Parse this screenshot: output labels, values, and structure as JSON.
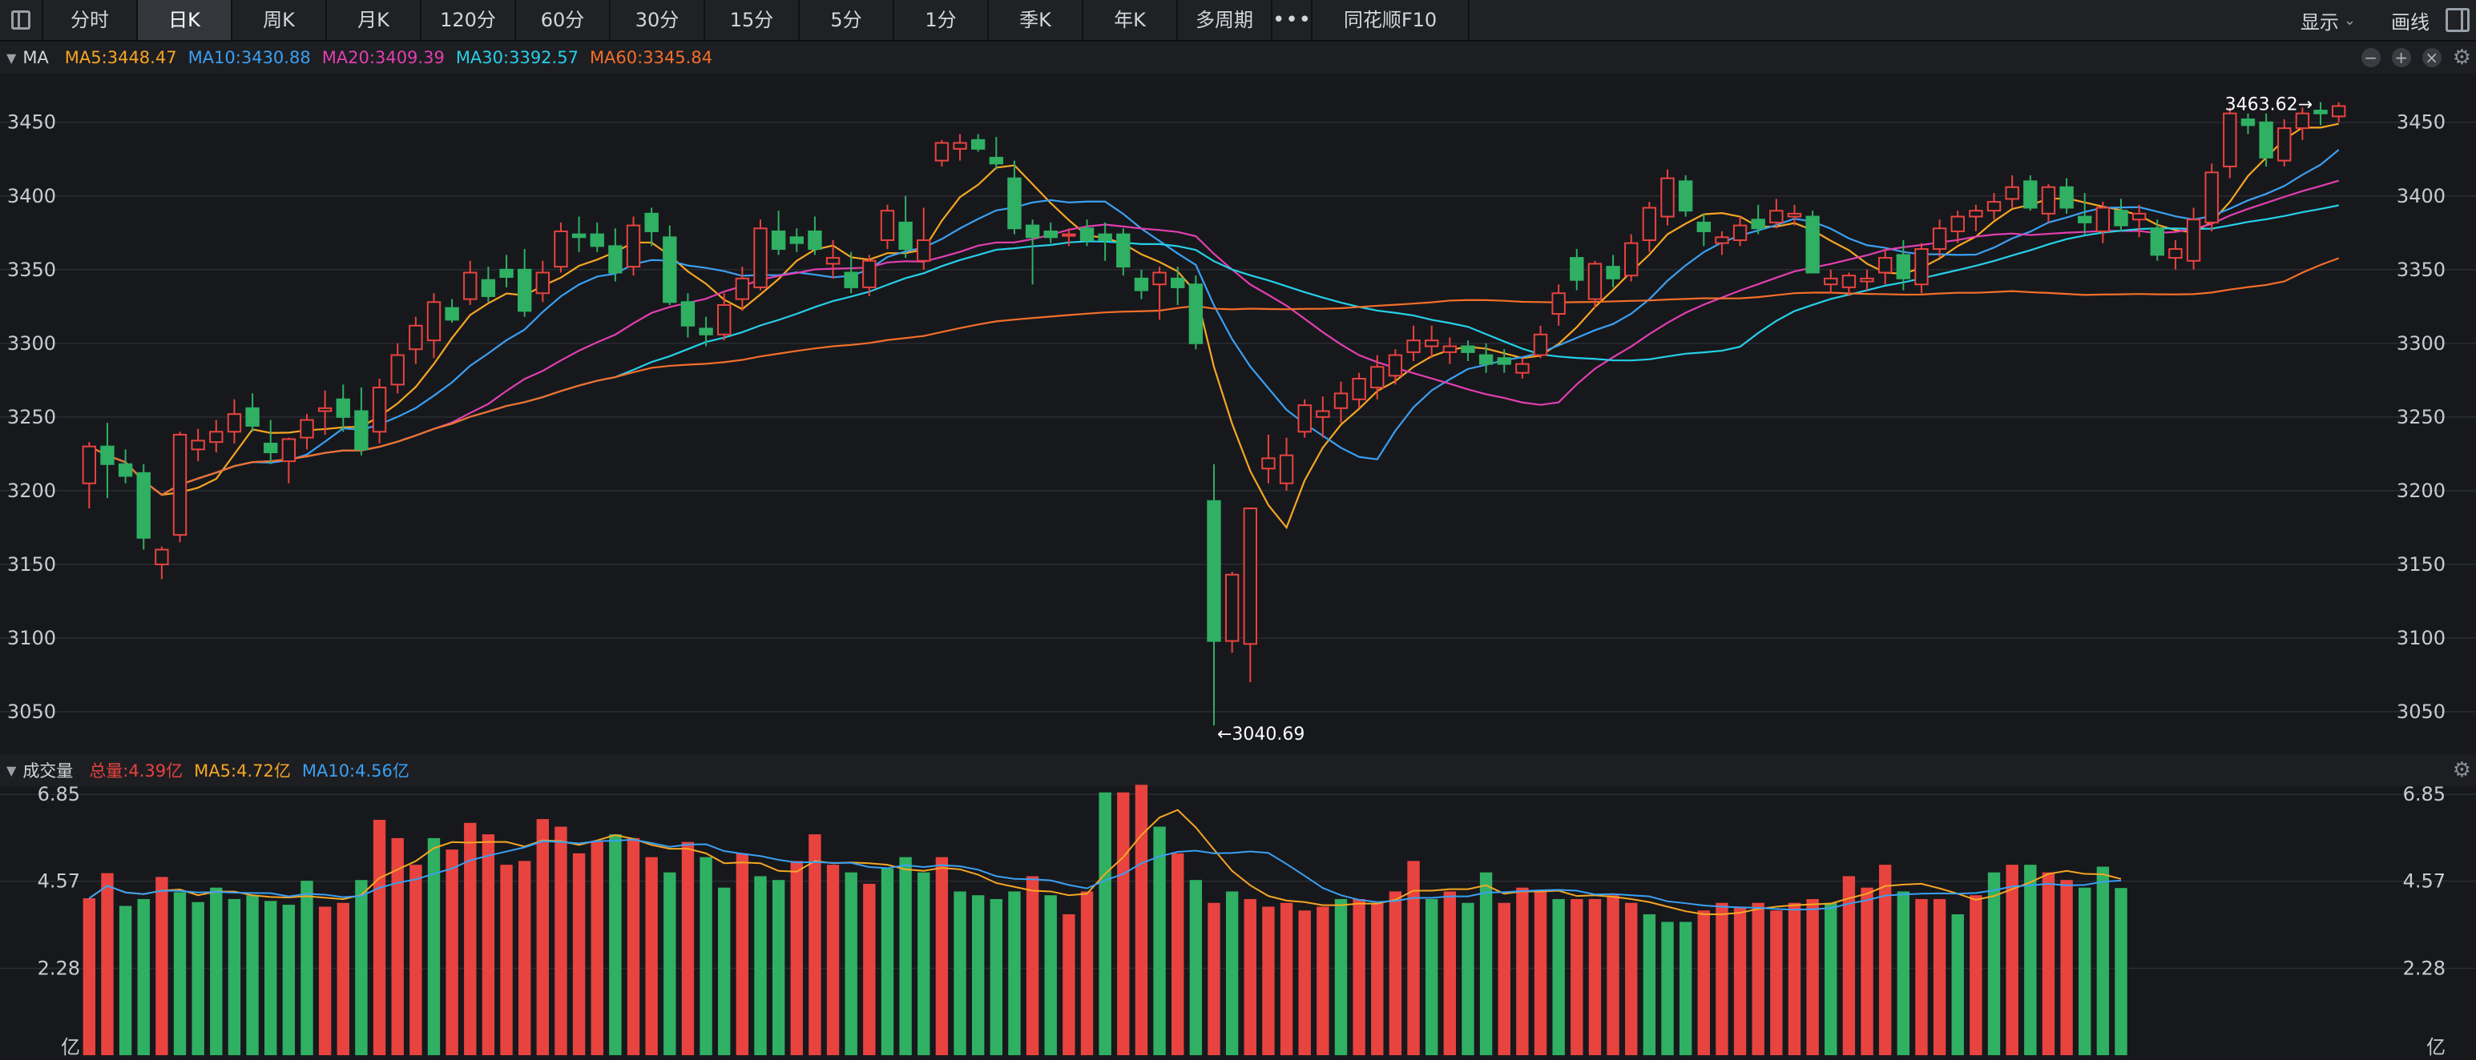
{
  "toolbar": {
    "tabs": [
      "分时",
      "日K",
      "周K",
      "月K",
      "120分",
      "60分",
      "30分",
      "15分",
      "5分",
      "1分",
      "季K",
      "年K",
      "多周期"
    ],
    "active_tab": "日K",
    "more": "•••",
    "f10": "同花顺F10",
    "display": "显示",
    "draw": "画线"
  },
  "ma_legend": {
    "name": "MA",
    "items": [
      {
        "label": "MA5:3448.47",
        "color": "#f5a623"
      },
      {
        "label": "MA10:3430.88",
        "color": "#3aa0f3"
      },
      {
        "label": "MA20:3409.39",
        "color": "#e23fb1"
      },
      {
        "label": "MA30:3392.57",
        "color": "#26d0e8"
      },
      {
        "label": "MA60:3345.84",
        "color": "#f36f2a"
      }
    ]
  },
  "vol_legend": {
    "name": "成交量",
    "items": [
      {
        "label": "总量:4.39亿",
        "color": "#e8433f"
      },
      {
        "label": "MA5:4.72亿",
        "color": "#f5a623"
      },
      {
        "label": "MA10:4.56亿",
        "color": "#3aa0f3"
      }
    ]
  },
  "colors": {
    "up": "#e8433f",
    "down": "#2fb063",
    "grid": "#2a2c31",
    "axis_text": "#c9cbd1"
  },
  "chart_data": {
    "type": "candlestick",
    "price_axis": {
      "ticks": [
        3050,
        3100,
        3150,
        3200,
        3250,
        3300,
        3350,
        3400,
        3450
      ],
      "ylim": [
        3025,
        3483
      ]
    },
    "annotations": {
      "max_label": "3463.62→",
      "min_label": "←3040.69",
      "max": 3463.62,
      "min": 3040.69
    },
    "ohlc": [
      [
        3205,
        3233,
        3188,
        3230
      ],
      [
        3230,
        3246,
        3195,
        3218
      ],
      [
        3218,
        3228,
        3205,
        3210
      ],
      [
        3212,
        3218,
        3160,
        3168
      ],
      [
        3150,
        3162,
        3140,
        3160
      ],
      [
        3170,
        3240,
        3165,
        3238
      ],
      [
        3228,
        3242,
        3220,
        3234
      ],
      [
        3233,
        3248,
        3226,
        3240
      ],
      [
        3240,
        3262,
        3232,
        3252
      ],
      [
        3256,
        3266,
        3240,
        3244
      ],
      [
        3232,
        3248,
        3218,
        3226
      ],
      [
        3220,
        3236,
        3205,
        3235
      ],
      [
        3236,
        3252,
        3228,
        3248
      ],
      [
        3254,
        3268,
        3238,
        3256
      ],
      [
        3262,
        3272,
        3240,
        3250
      ],
      [
        3254,
        3270,
        3224,
        3228
      ],
      [
        3240,
        3276,
        3232,
        3270
      ],
      [
        3272,
        3300,
        3266,
        3292
      ],
      [
        3296,
        3318,
        3286,
        3312
      ],
      [
        3302,
        3334,
        3290,
        3328
      ],
      [
        3324,
        3330,
        3314,
        3316
      ],
      [
        3330,
        3356,
        3326,
        3348
      ],
      [
        3343,
        3352,
        3328,
        3332
      ],
      [
        3350,
        3360,
        3338,
        3345
      ],
      [
        3350,
        3364,
        3318,
        3322
      ],
      [
        3334,
        3356,
        3328,
        3348
      ],
      [
        3352,
        3382,
        3348,
        3376
      ],
      [
        3374,
        3386,
        3362,
        3372
      ],
      [
        3374,
        3382,
        3362,
        3366
      ],
      [
        3366,
        3378,
        3342,
        3348
      ],
      [
        3352,
        3386,
        3346,
        3380
      ],
      [
        3388,
        3392,
        3366,
        3376
      ],
      [
        3372,
        3380,
        3326,
        3328
      ],
      [
        3328,
        3334,
        3304,
        3312
      ],
      [
        3310,
        3318,
        3298,
        3306
      ],
      [
        3306,
        3334,
        3302,
        3326
      ],
      [
        3330,
        3352,
        3322,
        3344
      ],
      [
        3338,
        3384,
        3336,
        3378
      ],
      [
        3376,
        3390,
        3360,
        3364
      ],
      [
        3372,
        3378,
        3362,
        3368
      ],
      [
        3376,
        3386,
        3360,
        3364
      ],
      [
        3354,
        3370,
        3344,
        3358
      ],
      [
        3348,
        3362,
        3334,
        3338
      ],
      [
        3338,
        3360,
        3332,
        3356
      ],
      [
        3370,
        3394,
        3364,
        3390
      ],
      [
        3382,
        3400,
        3358,
        3364
      ],
      [
        3356,
        3392,
        3350,
        3370
      ],
      [
        3424,
        3438,
        3420,
        3436
      ],
      [
        3432,
        3442,
        3424,
        3436
      ],
      [
        3438,
        3442,
        3430,
        3432
      ],
      [
        3426,
        3440,
        3418,
        3422
      ],
      [
        3412,
        3424,
        3374,
        3378
      ],
      [
        3380,
        3384,
        3340,
        3372
      ],
      [
        3376,
        3382,
        3368,
        3372
      ],
      [
        3374,
        3378,
        3366,
        3374
      ],
      [
        3378,
        3384,
        3366,
        3370
      ],
      [
        3374,
        3382,
        3356,
        3370
      ],
      [
        3374,
        3378,
        3346,
        3352
      ],
      [
        3344,
        3350,
        3330,
        3336
      ],
      [
        3340,
        3352,
        3316,
        3348
      ],
      [
        3344,
        3352,
        3326,
        3338
      ],
      [
        3340,
        3346,
        3296,
        3300
      ],
      [
        3193,
        3218,
        3040.69,
        3098
      ],
      [
        3098,
        3145,
        3090,
        3143
      ],
      [
        3096,
        3188,
        3070,
        3188
      ],
      [
        3215,
        3238,
        3205,
        3222
      ],
      [
        3205,
        3236,
        3200,
        3224
      ],
      [
        3240,
        3262,
        3236,
        3258
      ],
      [
        3250,
        3264,
        3236,
        3254
      ],
      [
        3256,
        3274,
        3246,
        3266
      ],
      [
        3262,
        3280,
        3256,
        3276
      ],
      [
        3270,
        3292,
        3262,
        3284
      ],
      [
        3278,
        3296,
        3272,
        3292
      ],
      [
        3294,
        3312,
        3288,
        3302
      ],
      [
        3298,
        3312,
        3290,
        3302
      ],
      [
        3294,
        3304,
        3286,
        3298
      ],
      [
        3298,
        3302,
        3288,
        3294
      ],
      [
        3292,
        3300,
        3280,
        3286
      ],
      [
        3290,
        3296,
        3280,
        3286
      ],
      [
        3280,
        3290,
        3276,
        3286
      ],
      [
        3292,
        3312,
        3290,
        3306
      ],
      [
        3320,
        3340,
        3312,
        3334
      ],
      [
        3358,
        3364,
        3336,
        3343
      ],
      [
        3330,
        3356,
        3324,
        3354
      ],
      [
        3352,
        3360,
        3338,
        3344
      ],
      [
        3346,
        3374,
        3342,
        3368
      ],
      [
        3370,
        3396,
        3362,
        3392
      ],
      [
        3386,
        3418,
        3380,
        3412
      ],
      [
        3410,
        3414,
        3386,
        3390
      ],
      [
        3382,
        3388,
        3366,
        3376
      ],
      [
        3368,
        3376,
        3360,
        3372
      ],
      [
        3370,
        3386,
        3366,
        3380
      ],
      [
        3384,
        3394,
        3374,
        3378
      ],
      [
        3382,
        3398,
        3378,
        3390
      ],
      [
        3386,
        3394,
        3380,
        3388
      ],
      [
        3386,
        3390,
        3348,
        3348
      ],
      [
        3340,
        3350,
        3334,
        3344
      ],
      [
        3338,
        3348,
        3332,
        3346
      ],
      [
        3342,
        3350,
        3336,
        3344
      ],
      [
        3348,
        3364,
        3340,
        3358
      ],
      [
        3360,
        3370,
        3336,
        3344
      ],
      [
        3340,
        3368,
        3334,
        3364
      ],
      [
        3364,
        3384,
        3358,
        3378
      ],
      [
        3376,
        3390,
        3368,
        3386
      ],
      [
        3386,
        3394,
        3376,
        3390
      ],
      [
        3390,
        3402,
        3384,
        3396
      ],
      [
        3398,
        3414,
        3392,
        3406
      ],
      [
        3410,
        3414,
        3390,
        3392
      ],
      [
        3388,
        3408,
        3382,
        3406
      ],
      [
        3406,
        3412,
        3388,
        3392
      ],
      [
        3386,
        3402,
        3374,
        3382
      ],
      [
        3376,
        3396,
        3368,
        3392
      ],
      [
        3390,
        3398,
        3376,
        3380
      ],
      [
        3384,
        3394,
        3372,
        3388
      ],
      [
        3378,
        3384,
        3356,
        3360
      ],
      [
        3358,
        3370,
        3350,
        3364
      ],
      [
        3356,
        3392,
        3350,
        3384
      ],
      [
        3382,
        3422,
        3376,
        3416
      ],
      [
        3420,
        3460,
        3412,
        3456
      ],
      [
        3452,
        3456,
        3442,
        3448
      ],
      [
        3450,
        3456,
        3420,
        3426
      ],
      [
        3424,
        3452,
        3420,
        3446
      ],
      [
        3446,
        3460,
        3438,
        3456
      ],
      [
        3458,
        3463.62,
        3448,
        3456
      ],
      [
        3454,
        3463.62,
        3450,
        3461
      ]
    ],
    "volume_axis": {
      "ticks": [
        2.28,
        4.57,
        6.85
      ],
      "unit": "亿",
      "ylim": [
        0,
        7.0
      ]
    },
    "volume": [
      4.12,
      4.78,
      3.92,
      4.1,
      4.68,
      4.28,
      4.02,
      4.4,
      4.1,
      4.2,
      4.05,
      3.95,
      4.58,
      3.9,
      4.0,
      4.6,
      6.18,
      5.7,
      5.0,
      5.7,
      5.4,
      6.1,
      5.8,
      5.0,
      5.1,
      6.2,
      6.0,
      5.3,
      5.6,
      5.8,
      5.7,
      5.2,
      4.8,
      5.6,
      5.2,
      4.4,
      5.3,
      4.7,
      4.6,
      5.1,
      5.8,
      5.0,
      4.8,
      4.5,
      4.9,
      5.2,
      4.8,
      5.2,
      4.3,
      4.2,
      4.1,
      4.3,
      4.7,
      4.2,
      3.7,
      4.3,
      6.9,
      6.9,
      7.1,
      6.0,
      5.3,
      4.6,
      4.0,
      4.3,
      4.1,
      3.9,
      4.0,
      3.8,
      3.9,
      4.1,
      4.1,
      4.0,
      4.3,
      5.1,
      4.1,
      4.3,
      4.0,
      4.8,
      4.0,
      4.4,
      4.3,
      4.1,
      4.1,
      4.1,
      4.2,
      4.0,
      3.7,
      3.5,
      3.5,
      3.8,
      4.0,
      3.9,
      4.0,
      3.8,
      4.0,
      4.1,
      4.0,
      4.7,
      4.4,
      5.0,
      4.3,
      4.1,
      4.1,
      3.7,
      4.2,
      4.8,
      5.0,
      5.0,
      4.8,
      4.6,
      4.4,
      4.95,
      4.39
    ],
    "volume_up": [
      1,
      1,
      0,
      0,
      1,
      0,
      0,
      0,
      0,
      0,
      0,
      0,
      0,
      1,
      1,
      0,
      1,
      1,
      1,
      0,
      1,
      1,
      1,
      1,
      1,
      1,
      1,
      1,
      1,
      0,
      1,
      1,
      0,
      1,
      0,
      0,
      1,
      0,
      0,
      1,
      1,
      1,
      0,
      1,
      0,
      0,
      0,
      1,
      0,
      0,
      0,
      0,
      1,
      0,
      1,
      1,
      0,
      1,
      1,
      0,
      1,
      0,
      1,
      0,
      1,
      1,
      1,
      1,
      1,
      0,
      1,
      1,
      1,
      1,
      0,
      1,
      0,
      0,
      1,
      1,
      1,
      0,
      1,
      1,
      1,
      1,
      0,
      0,
      0,
      1,
      1,
      1,
      1,
      1,
      1,
      1,
      0,
      1,
      1,
      1,
      0,
      1,
      1,
      0,
      1,
      0,
      1,
      0,
      1,
      1
    ]
  }
}
